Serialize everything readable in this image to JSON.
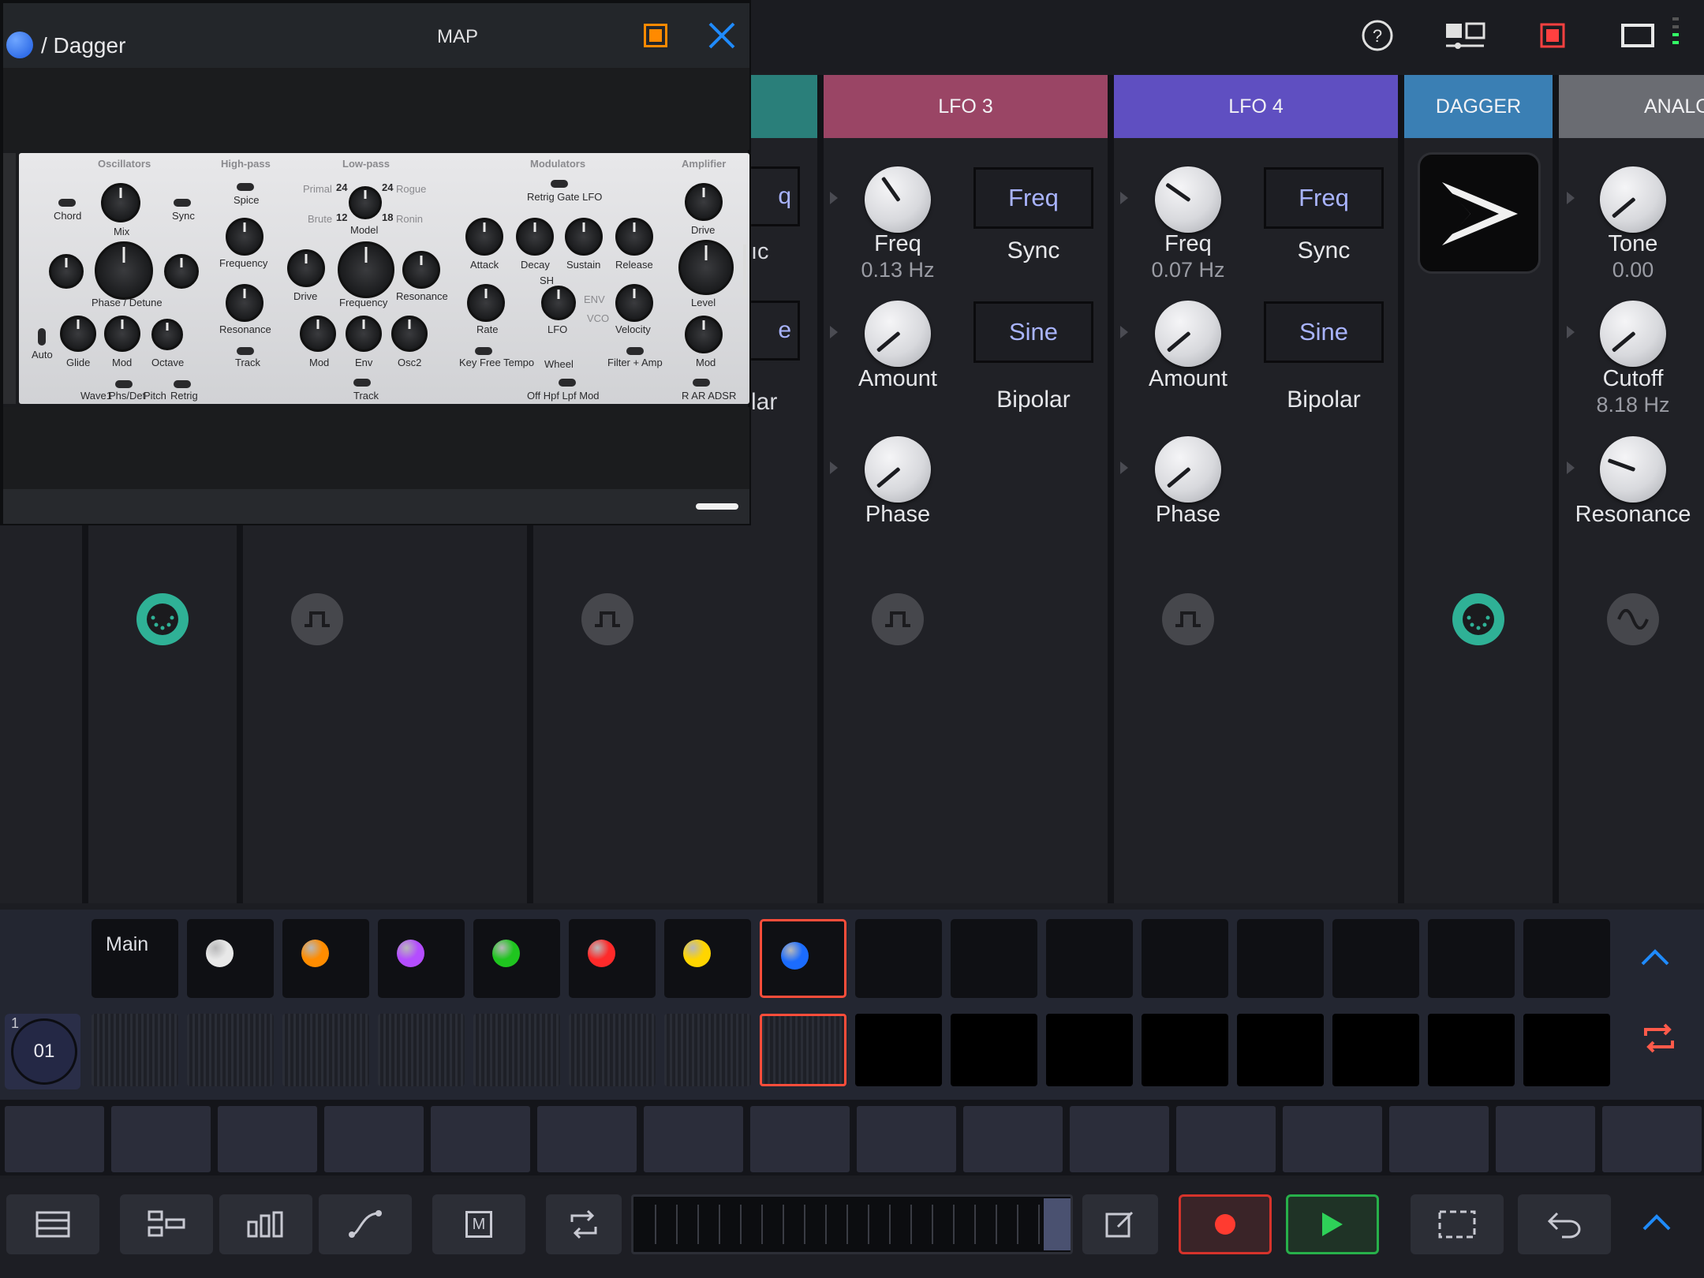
{
  "topbar": {
    "icons": [
      "help-icon",
      "layout-icon",
      "stop-record-icon",
      "window-icon",
      "level-meter-icon"
    ]
  },
  "columns": {
    "partial_left": {
      "box1": "q",
      "text1": "ıc",
      "box2": "e",
      "text2": "lar"
    },
    "lfo3": {
      "title": "LFO 3",
      "color": "#9a4565",
      "freq_label": "Freq",
      "freq_value": "0.13 Hz",
      "sync_box": "Freq",
      "sync_label": "Sync",
      "amount_label": "Amount",
      "wave_box": "Sine",
      "bipolar_label": "Bipolar",
      "phase_label": "Phase"
    },
    "lfo4": {
      "title": "LFO 4",
      "color": "#5f4fc1",
      "freq_label": "Freq",
      "freq_value": "0.07 Hz",
      "sync_box": "Freq",
      "sync_label": "Sync",
      "amount_label": "Amount",
      "wave_box": "Sine",
      "bipolar_label": "Bipolar",
      "phase_label": "Phase"
    },
    "dagger": {
      "title": "DAGGER",
      "color": "#3a7fb4"
    },
    "analog": {
      "title": "ANALOG",
      "color": "#6a6c72",
      "tone_label": "Tone",
      "tone_value": "0.00",
      "cutoff_label": "Cutoff",
      "cutoff_value": "8.18 Hz",
      "resonance_label": "Resonance"
    }
  },
  "plugin": {
    "title": "/ Dagger",
    "map_label": "MAP",
    "accent": "#ff8a00",
    "close_color": "#1f8bff",
    "sections": {
      "oscillators": "Oscillators",
      "highpass": "High-pass",
      "lowpass": "Low-pass",
      "modulators": "Modulators",
      "amplifier": "Amplifier"
    },
    "labels": {
      "chord": "Chord",
      "sync": "Sync",
      "mix": "Mix",
      "phase_detune": "Phase / Detune",
      "auto": "Auto",
      "glide": "Glide",
      "mod": "Mod",
      "octave": "Octave",
      "wave1": "Wave1",
      "phs_det": "Phs/Det",
      "pitch": "Pitch",
      "retrig": "Retrig",
      "spice": "Spice",
      "frequency": "Frequency",
      "resonance": "Resonance",
      "track": "Track",
      "primal": "Primal",
      "rogue": "Rogue",
      "brute": "Brute",
      "ronin": "Ronin",
      "model": "Model",
      "n24a": "24",
      "n24b": "24",
      "n12": "12",
      "n18": "18",
      "drive": "Drive",
      "lp_frequency": "Frequency",
      "lp_resonance": "Resonance",
      "lp_mod": "Mod",
      "env": "Env",
      "osc2": "Osc2",
      "lp_track": "Track",
      "retrig_gate_lfo": "Retrig Gate  LFO",
      "attack": "Attack",
      "decay": "Decay",
      "sustain": "Sustain",
      "release": "Release",
      "rate": "Rate",
      "lfo": "LFO",
      "sh": "SH",
      "env_lbl": "ENV",
      "vco": "VCO",
      "velocity": "Velocity",
      "key_free_tempo": "Key  Free  Tempo",
      "wheel": "Wheel",
      "wheel_opts": "Off  Hpf  Lpf  Mod",
      "filter_amp": "Filter  +  Amp",
      "amp_drive": "Drive",
      "level": "Level",
      "amp_mod": "Mod",
      "r_ar_adsr": "R     AR  ADSR"
    }
  },
  "tracks": {
    "main_label": "Main",
    "dots": [
      "#e8e8e8",
      "#ff8c00",
      "#b44dff",
      "#1fc51f",
      "#ff2a2a",
      "#ffd500",
      "#1b6cff"
    ],
    "pattern_number": "01",
    "pattern_index": "1",
    "selected_color": "#ff4d3a"
  },
  "transport": {
    "record_color": "#ff3b30",
    "play_color": "#2ed158",
    "icons": [
      "list-icon",
      "mixer-icon",
      "bars-icon",
      "curve-icon",
      "m-icon",
      "loop-icon",
      "edit-icon",
      "record-icon",
      "play-icon",
      "select-icon",
      "undo-icon",
      "chevron-up-icon"
    ],
    "m_label": "M"
  }
}
